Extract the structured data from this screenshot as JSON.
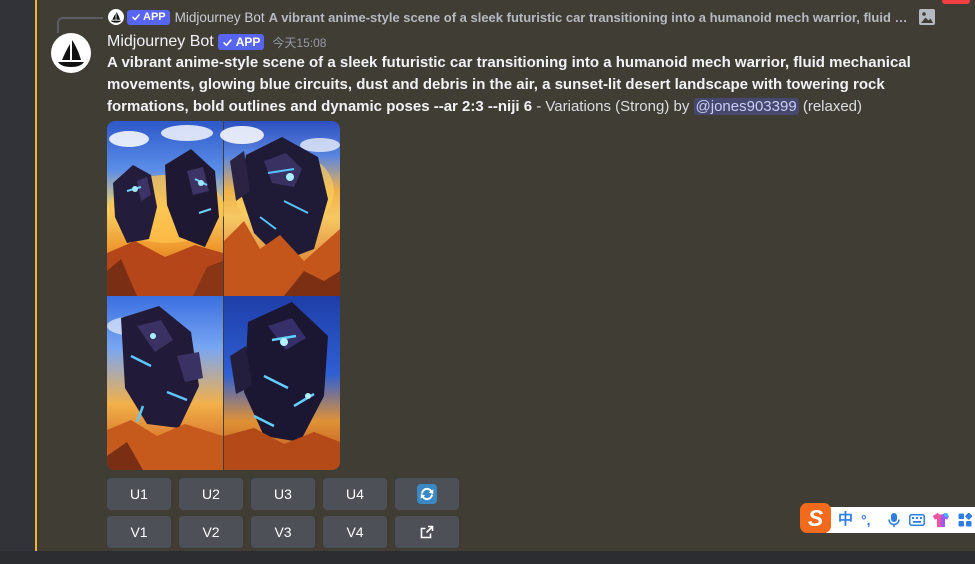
{
  "colors": {
    "mention_highlight_bar": "#f0b232",
    "message_highlight_bg": "#403d35",
    "app_badge": "#5865f2",
    "button_bg": "#4e5058",
    "ime_accent": "#2f7de1",
    "ime_logo": "#f26b1d"
  },
  "reply": {
    "avatar_icon": "midjourney-sailboat-icon",
    "badge_icon": "verified-check-icon",
    "badge": "APP",
    "author": "Midjourney Bot",
    "text": "A vibrant anime-style scene of a sleek futuristic car transitioning into a humanoid mech warrior, fluid …",
    "attachment_icon": "image-icon"
  },
  "message": {
    "avatar_icon": "midjourney-sailboat-icon",
    "author": "Midjourney Bot",
    "badge_icon": "verified-check-icon",
    "badge": "APP",
    "timestamp": "今天15:08",
    "prompt": "A vibrant anime-style scene of a sleek futuristic car transitioning into a humanoid mech warrior, fluid mechanical movements, glowing blue circuits, dust and debris in the air, a sunset-lit desert landscape with towering rock formations, bold outlines and dynamic poses --ar 2:3 --niji 6",
    "suffix": " - Variations (Strong) by ",
    "mention": "@jones903399",
    "mode": " (relaxed)"
  },
  "components": {
    "upscale_buttons": [
      "U1",
      "U2",
      "U3",
      "U4"
    ],
    "reroll_icon": "refresh-icon",
    "variation_buttons": [
      "V1",
      "V2",
      "V3",
      "V4"
    ],
    "web_icon": "external-link-icon"
  },
  "ime_toolbar": {
    "logo_letter": "S",
    "input_mode": "中",
    "punctuation_mode": "°,",
    "icons": [
      "microphone-icon",
      "keyboard-icon",
      "skin-icon",
      "toolbox-icon"
    ]
  }
}
